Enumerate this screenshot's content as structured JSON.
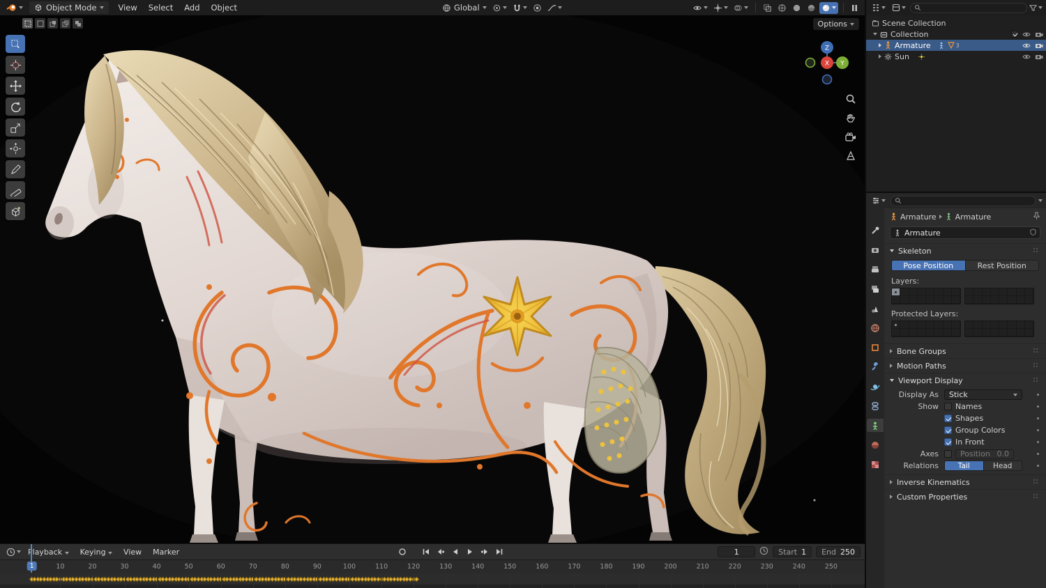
{
  "colors": {
    "accent": "#4772b3",
    "selection": "#3a5a88",
    "keyframe": "#f0bd3e",
    "decor_orange": "#e0772b",
    "flower_yellow": "#f2c53d"
  },
  "topbar": {
    "mode": "Object Mode",
    "menus": [
      "View",
      "Select",
      "Add",
      "Object"
    ],
    "orientation": "Global",
    "options": "Options"
  },
  "viewport": {
    "gizmo": {
      "x": "X",
      "y": "Y",
      "z": "Z"
    }
  },
  "outliner": {
    "rows": [
      {
        "label": "Scene Collection"
      },
      {
        "label": "Collection"
      },
      {
        "label": "Armature"
      },
      {
        "label": "Sun"
      }
    ],
    "armature_child_count": "3"
  },
  "properties": {
    "breadcrumb": {
      "object": "Armature",
      "data": "Armature"
    },
    "name_value": "Armature",
    "active_tab": "object-data",
    "tabs": [
      "tool",
      "render",
      "output",
      "view-layer",
      "scene",
      "world",
      "object",
      "modifiers",
      "physics",
      "constraints",
      "object-data",
      "material",
      "texture"
    ],
    "skeleton": {
      "title": "Skeleton",
      "pose_button": "Pose Position",
      "rest_button": "Rest Position",
      "layers_label": "Layers:",
      "protected_label": "Protected Layers:"
    },
    "sections": {
      "bone_groups": "Bone Groups",
      "motion_paths": "Motion Paths",
      "viewport_display": "Viewport Display",
      "inverse_kinematics": "Inverse Kinematics",
      "custom_properties": "Custom Properties"
    },
    "viewport_display": {
      "display_as_label": "Display As",
      "display_as_value": "Stick",
      "show_label": "Show",
      "checks": [
        {
          "label": "Names",
          "checked": false
        },
        {
          "label": "Shapes",
          "checked": true
        },
        {
          "label": "Group Colors",
          "checked": true
        },
        {
          "label": "In Front",
          "checked": true
        }
      ],
      "axes_label": "Axes",
      "position_label": "Position",
      "position_value": "0.0",
      "relations_label": "Relations",
      "tail_button": "Tail",
      "head_button": "Head"
    }
  },
  "timeline": {
    "menus": [
      "Playback",
      "Keying",
      "View",
      "Marker"
    ],
    "current_frame": "1",
    "start_label": "Start",
    "start_value": "1",
    "end_label": "End",
    "end_value": "250",
    "tick_frames": [
      10,
      20,
      30,
      40,
      50,
      60,
      70,
      80,
      90,
      100,
      110,
      120,
      130,
      140,
      150,
      160,
      170,
      180,
      190,
      200,
      210,
      220,
      230,
      240,
      250
    ],
    "keyframes": {
      "from": 1,
      "to": 121
    }
  }
}
